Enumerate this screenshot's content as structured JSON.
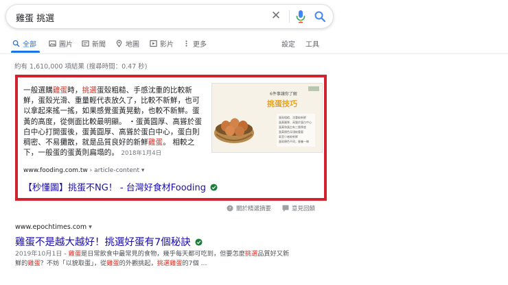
{
  "search": {
    "query": "雞蛋 挑選"
  },
  "tabs": [
    {
      "label": "全部",
      "icon": "search-icon"
    },
    {
      "label": "圖片",
      "icon": "image-icon"
    },
    {
      "label": "新聞",
      "icon": "news-icon"
    },
    {
      "label": "地圖",
      "icon": "map-pin-icon"
    },
    {
      "label": "影片",
      "icon": "video-icon"
    },
    {
      "label": "更多",
      "icon": "more-icon"
    }
  ],
  "tools": {
    "settings": "設定",
    "tools": "工具"
  },
  "stats": "約有 1,610,000 項結果 (搜尋時間：0.47 秒)",
  "featured": {
    "text_segments": [
      {
        "t": "一般選購",
        "hl": false
      },
      {
        "t": "雞蛋",
        "hl": true
      },
      {
        "t": "時，",
        "hl": false
      },
      {
        "t": "挑選",
        "hl": true
      },
      {
        "t": "蛋殼粗糙、手感沈重的比較新鮮，蛋殼光滑、重量輕代表放久了，比較不新鮮，也可以拿起來搖一搖，如果感覺蛋黃晃動，也較不新鮮。蛋黃的高度，從側面比較最明顯。 ・蛋黃圓厚、高聳於蛋白中心打開蛋後，蛋黃圓厚、高聳於蛋白中心，蛋白則稠密、不易攤散，就是品質良好的新鮮",
        "hl": false
      },
      {
        "t": "雞蛋",
        "hl": true
      },
      {
        "t": "。 相較之下，一般蛋的蛋黃則扁塌的。",
        "hl": false
      }
    ],
    "date": "2018年1月4日",
    "url_domain": "www.fooding.com.tw",
    "url_path": " › article-content",
    "title": "【秒懂圖】挑蛋不NG！ - 台灣好食材Fooding",
    "image": {
      "header": "6件事讓你了解",
      "title": "挑蛋技巧",
      "items": [
        "蛋殼粗糙、沈重較新鮮",
        "蛋黃圓厚、高聳於蛋白中心",
        "蛋黃和蛋白有三層厚度",
        "蛋黃顏色深淺較重要",
        "氣室小者較新鮮",
        "蛋殼顏色不同，營養一樣"
      ]
    },
    "colors": {
      "highlight_border": "#d0232f",
      "link": "#1a0dab",
      "term": "#d93025"
    }
  },
  "feedback": {
    "about": "關於精選摘要",
    "report": "意見回饋"
  },
  "result2": {
    "url": "www.epochtimes.com",
    "title": "雞蛋不是越大越好！挑選好蛋有7個秘訣",
    "date": "2019年10月1日",
    "snippet_line1_segments": [
      {
        "t": " - ",
        "hl": false
      },
      {
        "t": "雞蛋",
        "hl": true
      },
      {
        "t": "是日常飲食中最常見的食物，幾乎每天都可吃到，但要怎麼",
        "hl": false
      },
      {
        "t": "挑選",
        "hl": true
      },
      {
        "t": "品質好又新",
        "hl": false
      }
    ],
    "snippet_line2_segments": [
      {
        "t": "鮮的",
        "hl": false
      },
      {
        "t": "雞蛋",
        "hl": true
      },
      {
        "t": "？不妨「以貌取蛋」，從",
        "hl": false
      },
      {
        "t": "雞蛋",
        "hl": true
      },
      {
        "t": "的外觀挑起，",
        "hl": false
      },
      {
        "t": "挑選雞蛋",
        "hl": true
      },
      {
        "t": "的7個 ...",
        "hl": false
      }
    ]
  }
}
